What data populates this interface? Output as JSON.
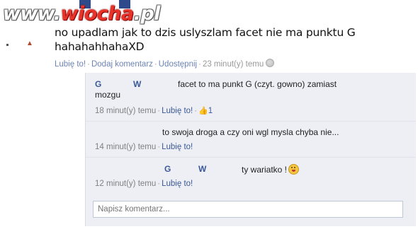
{
  "watermark": {
    "prefix": "www.",
    "accent": "wiocha",
    "suffix": ".pl"
  },
  "post": {
    "line1": "no upadlam jak to dzis uslyszlam facet nie ma punktu G",
    "line2": "hahahahhahaXD",
    "like_label": "Lubię to!",
    "comment_label": "Dodaj komentarz",
    "share_label": "Udostępnij",
    "time": "23 minut(y) temu"
  },
  "comments": [
    {
      "name_first": "G",
      "name_last": "W",
      "text_line1": "facet to ma punkt G (czyt. gowno) zamiast",
      "text_line2": "mozgu",
      "time": "18 minut(y) temu",
      "like_label": "Lubię to!",
      "like_count": "1"
    },
    {
      "text": "to swoja droga a czy oni wgl mysla chyba nie...",
      "time": "14 minut(y) temu",
      "like_label": "Lubię to!"
    },
    {
      "name_first": "G",
      "name_last": "W",
      "text": "ty wariatko !",
      "time": "12 minut(y) temu",
      "like_label": "Lubię to!"
    }
  ],
  "input": {
    "placeholder": "Napisz komentarz..."
  }
}
